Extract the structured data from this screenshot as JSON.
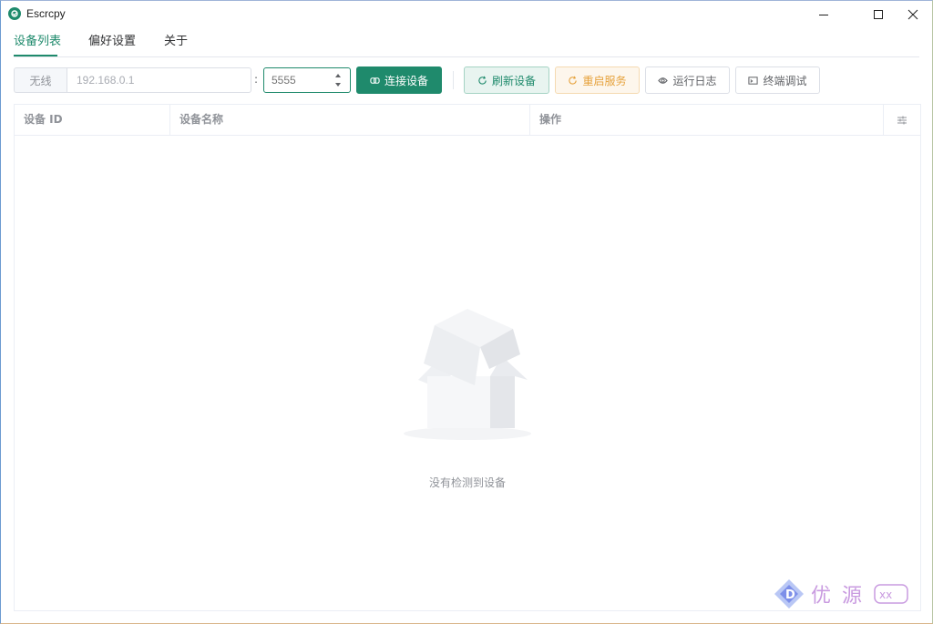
{
  "window": {
    "title": "Escrcpy",
    "brand_color": "#1f8a6c"
  },
  "tabs": [
    {
      "label": "设备列表",
      "active": true
    },
    {
      "label": "偏好设置",
      "active": false
    },
    {
      "label": "关于",
      "active": false
    }
  ],
  "toolbar": {
    "wireless_label": "无线",
    "ip_placeholder": "192.168.0.1",
    "colon": ":",
    "port_placeholder": "5555",
    "connect_label": "连接设备",
    "refresh_label": "刷新设备",
    "restart_label": "重启服务",
    "log_label": "运行日志",
    "terminal_label": "终端调试"
  },
  "table": {
    "columns": [
      "设备 ID",
      "设备名称",
      "操作"
    ],
    "empty_text": "没有检测到设备"
  },
  "icons": {
    "connect": "link-icon",
    "refresh": "refresh-icon",
    "restart": "restart-icon",
    "log": "eye-icon",
    "terminal": "terminal-icon",
    "settings": "sliders-icon"
  }
}
